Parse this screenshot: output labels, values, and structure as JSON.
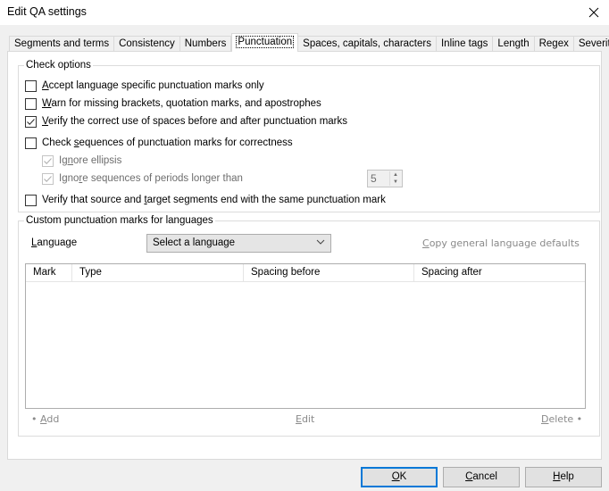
{
  "window": {
    "title": "Edit QA settings",
    "close_icon": "close-icon"
  },
  "tabs": [
    {
      "label": "Segments and terms",
      "active": false
    },
    {
      "label": "Consistency",
      "active": false
    },
    {
      "label": "Numbers",
      "active": false
    },
    {
      "label": "Punctuation",
      "active": true
    },
    {
      "label": "Spaces, capitals, characters",
      "active": false
    },
    {
      "label": "Inline tags",
      "active": false
    },
    {
      "label": "Length",
      "active": false
    },
    {
      "label": "Regex",
      "active": false
    },
    {
      "label": "Severity",
      "active": false
    }
  ],
  "check_options": {
    "legend": "Check options",
    "items": [
      {
        "pre": "",
        "key": "A",
        "post": "ccept language specific punctuation marks only",
        "checked": false,
        "enabled": true
      },
      {
        "pre": "",
        "key": "W",
        "post": "arn for missing brackets, quotation marks, and apostrophes",
        "checked": false,
        "enabled": true
      },
      {
        "pre": "",
        "key": "V",
        "post": "erify the correct use of spaces before and after punctuation marks",
        "checked": true,
        "enabled": true
      },
      {
        "pre": "Check ",
        "key": "s",
        "post": "equences of punctuation marks for correctness",
        "checked": false,
        "enabled": true
      },
      {
        "pre": "Ig",
        "key": "n",
        "post": "ore ellipsis",
        "checked": true,
        "enabled": false
      },
      {
        "pre": "Igno",
        "key": "r",
        "post": "e sequences of periods longer than",
        "checked": true,
        "enabled": false
      },
      {
        "pre": "Verify that source and ",
        "key": "t",
        "post": "arget segments end with the same punctuation mark",
        "checked": false,
        "enabled": true
      }
    ],
    "period_length": {
      "value": "5",
      "enabled": false
    }
  },
  "custom_marks": {
    "legend": "Custom punctuation marks for languages",
    "language_label_key": "L",
    "language_label_rest": "anguage",
    "language_select": {
      "value": "Select a language"
    },
    "copy_defaults_key": "C",
    "copy_defaults_rest": "opy general language defaults",
    "table": {
      "columns": [
        "Mark",
        "Type",
        "Spacing before",
        "Spacing after"
      ],
      "rows": []
    },
    "add_key": "A",
    "add_rest": "dd",
    "edit_key": "E",
    "edit_rest": "dit",
    "delete_key": "D",
    "delete_rest": "elete"
  },
  "buttons": {
    "ok_key": "O",
    "ok_rest": "K",
    "cancel_key": "C",
    "cancel_rest": "ancel",
    "help_key": "H",
    "help_rest": "elp"
  },
  "colors": {
    "accent": "#0078d7",
    "disabled_text": "#6d6d6d",
    "link_grey": "#8a8a8a"
  }
}
